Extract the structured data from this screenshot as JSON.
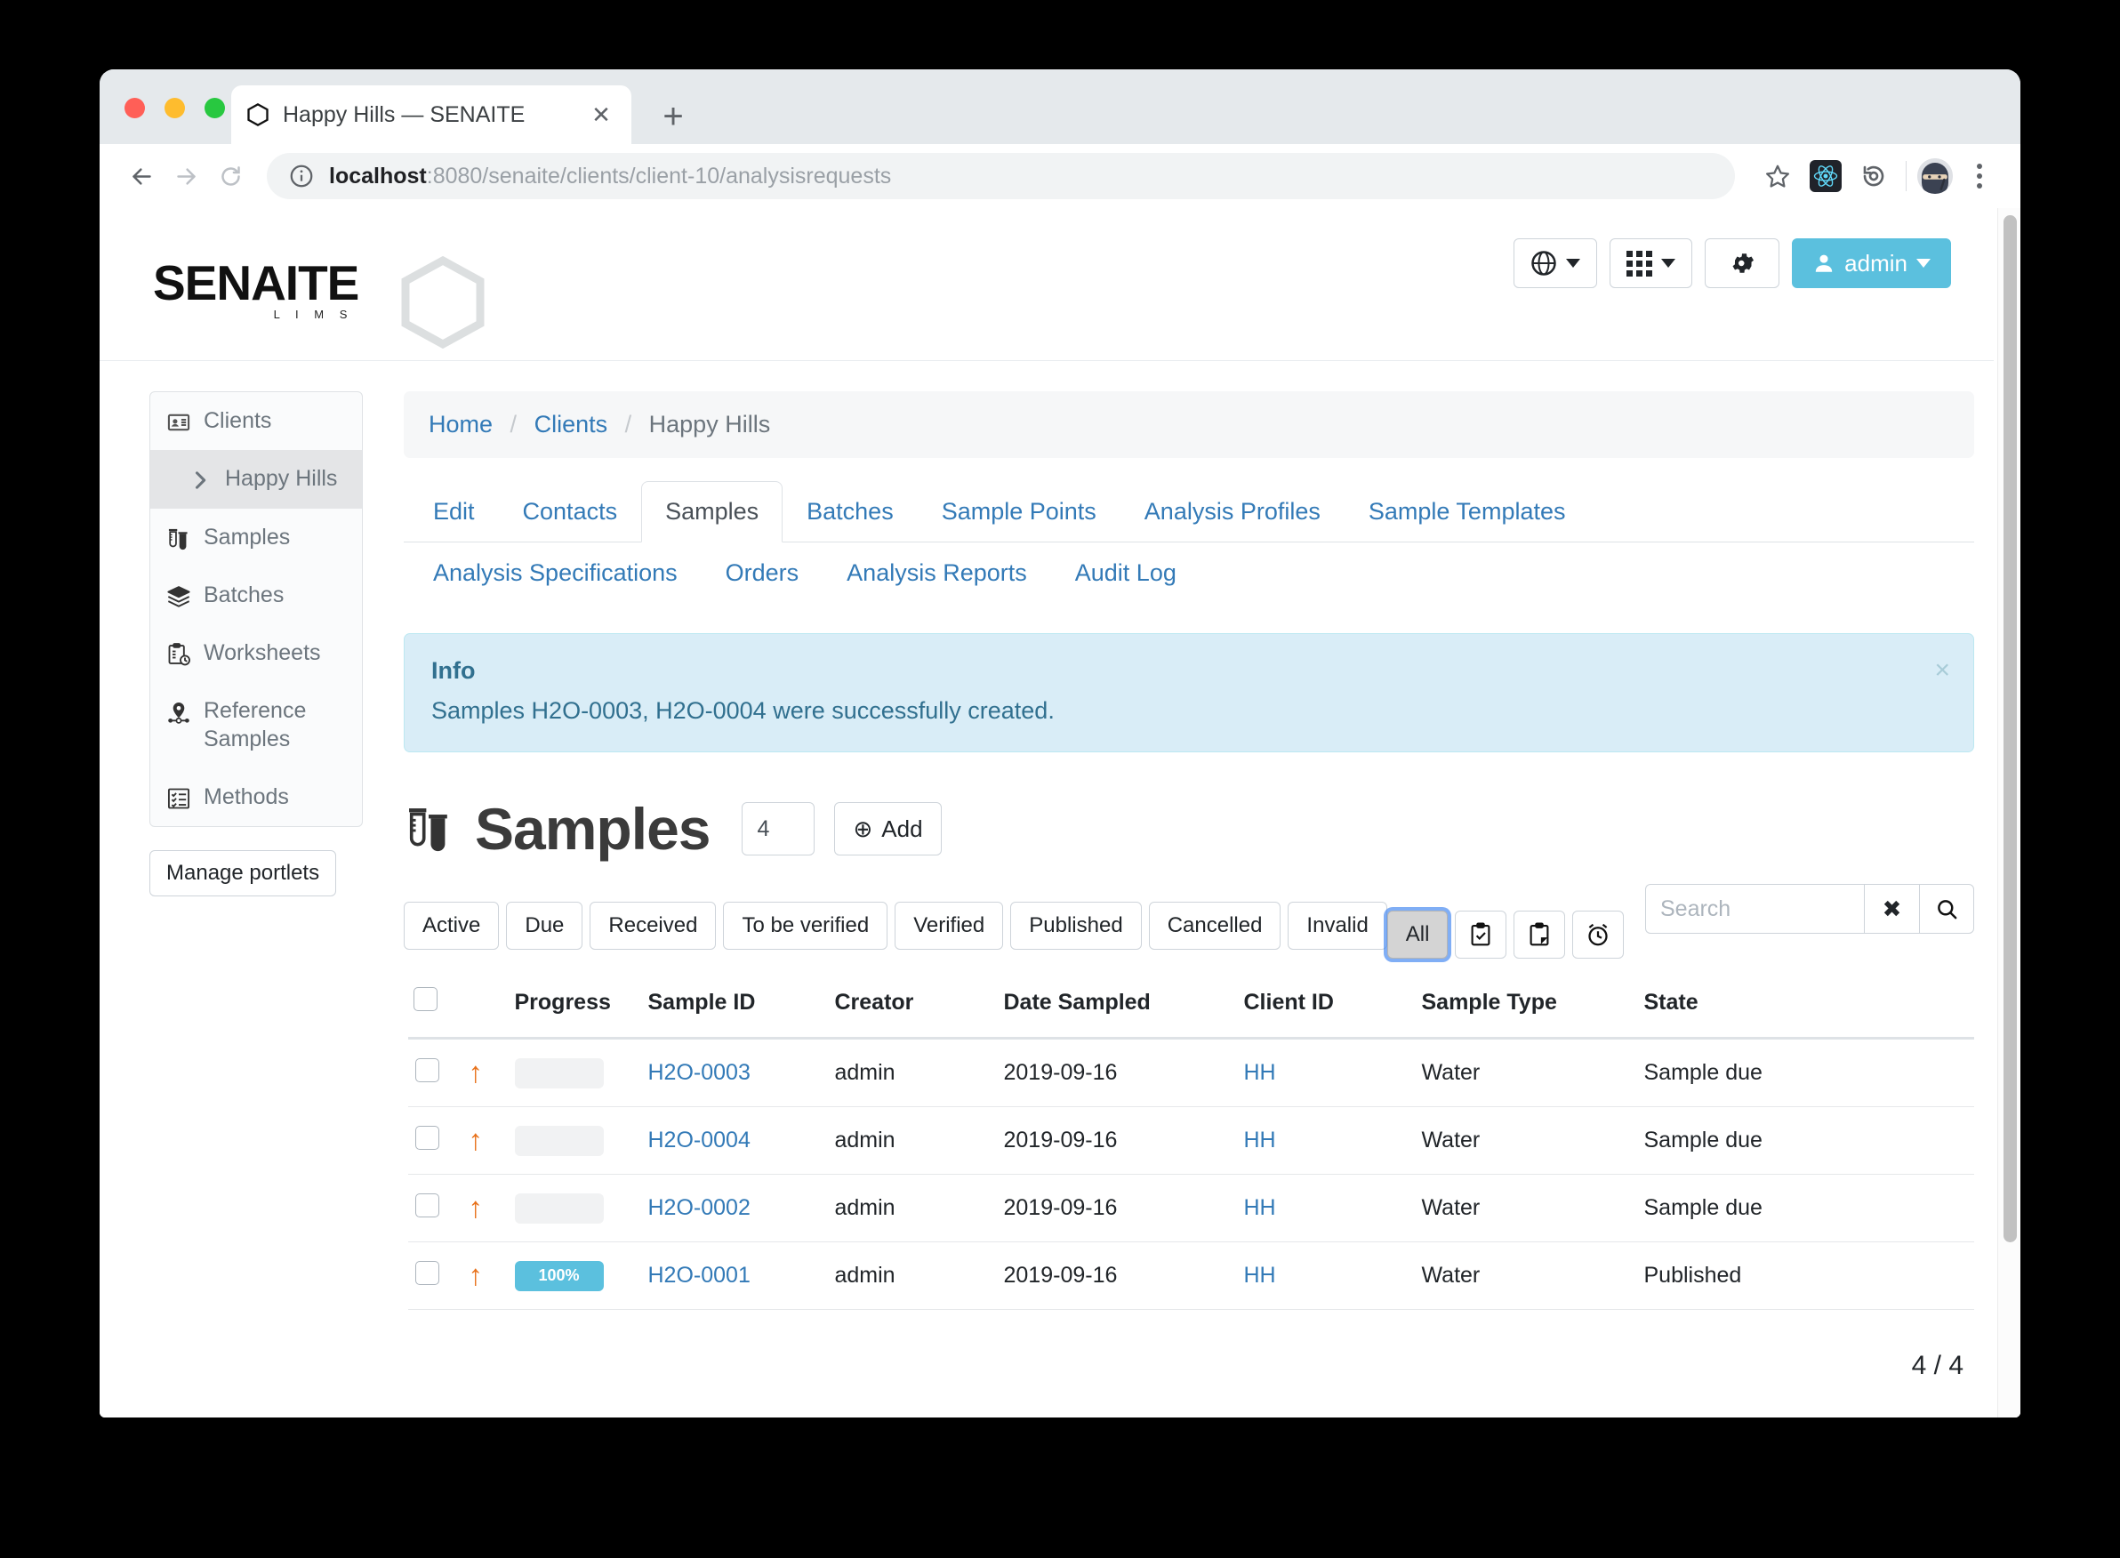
{
  "browser": {
    "tab_title": "Happy Hills — SENAITE",
    "new_tab_label": "+",
    "close_tab_label": "✕",
    "url_host": "localhost",
    "url_path": ":8080/senaite/clients/client-10/analysisrequests",
    "icons": {
      "back": "back-arrow-icon",
      "forward": "forward-arrow-icon",
      "reload": "reload-icon",
      "info": "site-info-icon",
      "bookmark": "star-icon",
      "react": "react-devtools-icon",
      "history": "history-icon",
      "profile": "ninja-avatar-icon",
      "menu": "kebab-menu-icon"
    }
  },
  "header": {
    "logo_word": "SENAITE",
    "logo_sub": "L I M S",
    "actions": {
      "language_label": "",
      "apps_label": "",
      "settings_label": "",
      "user_label": "admin"
    }
  },
  "sidebar": {
    "items": [
      {
        "label": "Clients",
        "icon": "id-card-icon",
        "active": false
      },
      {
        "label": "Happy Hills",
        "icon": "chevron-right-icon",
        "active": true
      },
      {
        "label": "Samples",
        "icon": "test-tube-icon",
        "active": false
      },
      {
        "label": "Batches",
        "icon": "layers-icon",
        "active": false
      },
      {
        "label": "Worksheets",
        "icon": "clipboard-clock-icon",
        "active": false
      },
      {
        "label": "Reference Samples",
        "icon": "location-pin-icon",
        "active": false
      },
      {
        "label": "Methods",
        "icon": "checklist-icon",
        "active": false
      }
    ],
    "manage_portlets": "Manage portlets"
  },
  "breadcrumb": {
    "home": "Home",
    "clients": "Clients",
    "current": "Happy Hills",
    "separator": "/"
  },
  "tabs": {
    "row1": [
      {
        "label": "Edit",
        "active": false
      },
      {
        "label": "Contacts",
        "active": false
      },
      {
        "label": "Samples",
        "active": true
      },
      {
        "label": "Batches",
        "active": false
      },
      {
        "label": "Sample Points",
        "active": false
      },
      {
        "label": "Analysis Profiles",
        "active": false
      },
      {
        "label": "Sample Templates",
        "active": false
      }
    ],
    "row2": [
      {
        "label": "Analysis Specifications",
        "active": false
      },
      {
        "label": "Orders",
        "active": false
      },
      {
        "label": "Analysis Reports",
        "active": false
      },
      {
        "label": "Audit Log",
        "active": false
      }
    ]
  },
  "alert": {
    "title": "Info",
    "message": "Samples H2O-0003, H2O-0004 were successfully created.",
    "close": "×"
  },
  "listing": {
    "title": "Samples",
    "count_value": "4",
    "add_label": "Add",
    "add_icon": "⊕",
    "filters_primary": [
      {
        "label": "Active",
        "active": false
      },
      {
        "label": "Due",
        "active": false
      },
      {
        "label": "Received",
        "active": false
      },
      {
        "label": "To be verified",
        "active": false
      },
      {
        "label": "Verified",
        "active": false
      },
      {
        "label": "Published",
        "active": false
      },
      {
        "label": "Cancelled",
        "active": false
      },
      {
        "label": "Invalid",
        "active": false
      }
    ],
    "filters_secondary": [
      {
        "label": "All",
        "active": true,
        "icon": ""
      },
      {
        "label": "",
        "active": false,
        "icon": "clipboard-check-icon"
      },
      {
        "label": "",
        "active": false,
        "icon": "clipboard-pencil-icon"
      },
      {
        "label": "",
        "active": false,
        "icon": "alarm-clock-icon"
      }
    ],
    "search": {
      "placeholder": "Search",
      "value": "",
      "clear_icon": "✖",
      "search_icon": "search-icon"
    },
    "columns": [
      "",
      "",
      "Progress",
      "Sample ID",
      "Creator",
      "Date Sampled",
      "Client ID",
      "Sample Type",
      "State"
    ],
    "rows": [
      {
        "priority_color": "yellow",
        "priority_icon": "arrow-up-icon",
        "progress_pct": 0,
        "progress_label": "",
        "sample_id": "H2O-0003",
        "creator": "admin",
        "date_sampled": "2019-09-16",
        "client_id": "HH",
        "sample_type": "Water",
        "state": "Sample due"
      },
      {
        "priority_color": "yellow",
        "priority_icon": "arrow-up-icon",
        "progress_pct": 0,
        "progress_label": "",
        "sample_id": "H2O-0004",
        "creator": "admin",
        "date_sampled": "2019-09-16",
        "client_id": "HH",
        "sample_type": "Water",
        "state": "Sample due"
      },
      {
        "priority_color": "yellow",
        "priority_icon": "arrow-up-icon",
        "progress_pct": 0,
        "progress_label": "",
        "sample_id": "H2O-0002",
        "creator": "admin",
        "date_sampled": "2019-09-16",
        "client_id": "HH",
        "sample_type": "Water",
        "state": "Sample due"
      },
      {
        "priority_color": "green",
        "priority_icon": "arrow-up-icon",
        "progress_pct": 100,
        "progress_label": "100%",
        "sample_id": "H2O-0001",
        "creator": "admin",
        "date_sampled": "2019-09-16",
        "client_id": "HH",
        "sample_type": "Water",
        "state": "Published"
      }
    ],
    "pagination": "4 / 4"
  },
  "colors": {
    "accent": "#5bc0de",
    "link": "#337ab7",
    "alert_bg": "#d9edf7",
    "alert_border": "#bce8f1",
    "alert_text": "#31708f",
    "priority_arrow": "#e8711a",
    "row_yellow": "#f5e663",
    "row_green": "#22b24c"
  }
}
